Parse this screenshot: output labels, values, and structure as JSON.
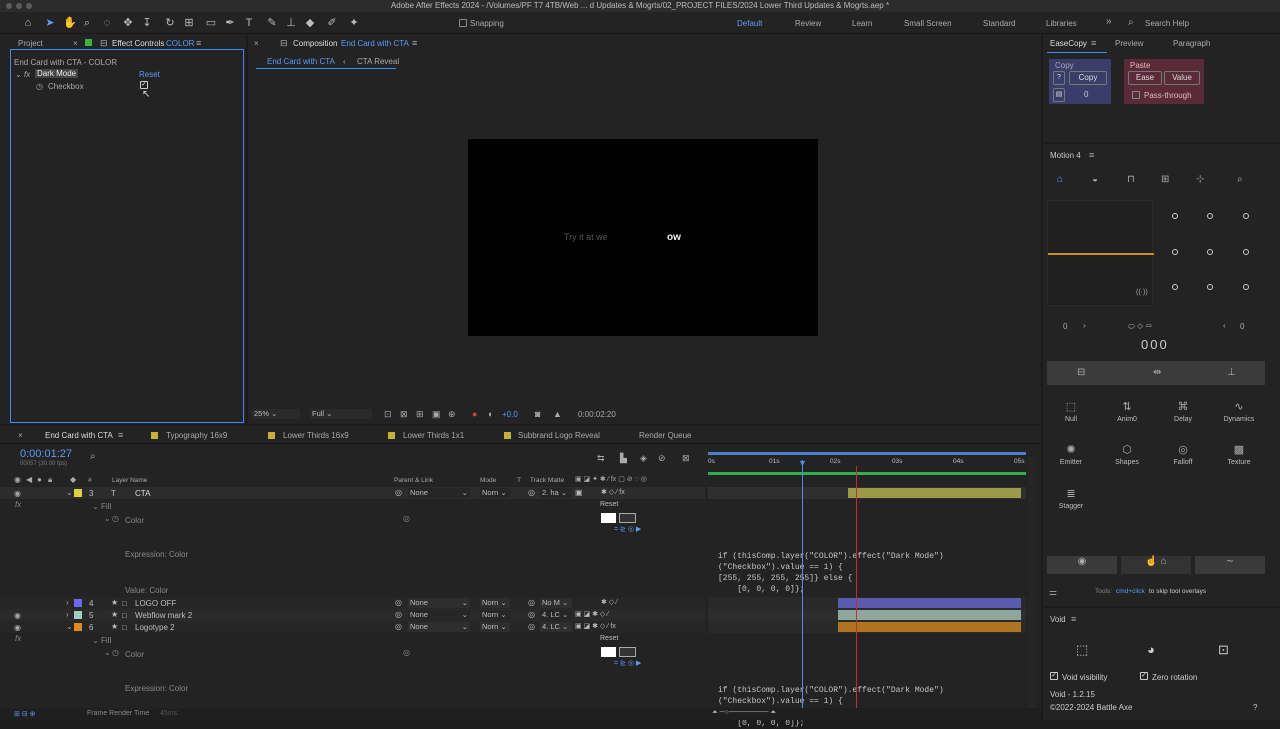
{
  "window": {
    "title": "Adobe After Effects 2024 - /Volumes/PF T7 4TB/Web ... d Updates & Mogrts/02_PROJECT FILES/2024 Lower Third Updates & Mogrts.aep *"
  },
  "toolbar": {
    "snapping": "Snapping",
    "workspaces": [
      "Default",
      "Review",
      "Learn",
      "Small Screen",
      "Standard",
      "Libraries"
    ],
    "more": "»",
    "search_placeholder": "Search Help"
  },
  "project_tab": "Project",
  "effect_controls": {
    "tab": "Effect Controls",
    "tab_layer": "COLOR",
    "header": "End Card with CTA - COLOR",
    "fx": "fx",
    "effect_name": "Dark Mode",
    "reset": "Reset",
    "checkbox_label": "Checkbox"
  },
  "composition": {
    "tab": "Composition",
    "tab_name": "End Card with CTA",
    "breadcrumb_current": "End Card with CTA",
    "breadcrumb_next": "CTA Reveal",
    "comp_text_dim": "Try it at we",
    "comp_text_bright": "ow",
    "zoom": "25%",
    "resolution": "Full",
    "exposure": "+0.0",
    "timecode": "0:00:02:20"
  },
  "timeline": {
    "tabs": [
      "End Card with CTA",
      "Typography 16x9",
      "Lower Thirds 16x9",
      "Lower Thirds 1x1",
      "Subbrand Logo Reveal",
      "Render Queue"
    ],
    "timecode": "0:00:01:27",
    "fps": "00057 (30.00 fps)",
    "col_hash": "#",
    "col_layer": "Layer Name",
    "col_parent": "Parent & Link",
    "col_mode": "Mode",
    "col_t": "T",
    "col_trackmatte": "Track Matte",
    "ruler": [
      "0s",
      "01s",
      "02s",
      "03s",
      "04s",
      "05s"
    ],
    "layers": [
      {
        "num": "3",
        "name": "CTA",
        "type": "T",
        "color": "#e0d040",
        "parent": "None",
        "mode": "Norn",
        "matte": "2. ha"
      },
      {
        "num": "4",
        "name": "LOGO OFF",
        "type": "□",
        "color": "#6a6aee",
        "parent": "None",
        "mode": "Norn",
        "matte": "No M"
      },
      {
        "num": "5",
        "name": "Webflow mark 2",
        "type": "□",
        "color": "#9ed0c2",
        "parent": "None",
        "mode": "Norn",
        "matte": "4. LC"
      },
      {
        "num": "6",
        "name": "Logotype 2",
        "type": "□",
        "color": "#e08a20",
        "parent": "None",
        "mode": "Norn",
        "matte": "4. LC"
      }
    ],
    "fill": "Fill",
    "color": "Color",
    "reset": "Reset",
    "expression": "Expression: Color",
    "value_color": "Value: Color",
    "code_lines": [
      "if (thisComp.layer(\"COLOR\").effect(\"Dark Mode\")",
      "(\"Checkbox\").value == 1) {",
      "[255, 255, 255, 255]} else {",
      "    [0, 0, 0, 0]};"
    ],
    "status": "Frame Render Time",
    "render_time": "45ms"
  },
  "easecopy": {
    "tabs": [
      "EaseCopy",
      "Preview",
      "Paragraph"
    ],
    "copy_label": "Copy",
    "copy_btn": "Copy",
    "help": "?",
    "zero": "0",
    "paste_label": "Paste",
    "ease_btn": "Ease",
    "value_btn": "Value",
    "passthrough": "Pass-through"
  },
  "motion": {
    "title": "Motion 4",
    "left_val": "0",
    "right_val": "0",
    "counter": "000",
    "tools": [
      "Null",
      "Anim0",
      "Delay",
      "Dynamics",
      "Emitter",
      "Shapes",
      "Falloff",
      "Texture",
      "Stagger"
    ],
    "hint_prefix": "Tools:",
    "hint_key": "cmd+click",
    "hint_rest": "to skip tool overlays"
  },
  "void": {
    "title": "Void",
    "visibility": "Void visibility",
    "zero_rotation": "Zero rotation",
    "version": "Void - 1.2.15",
    "copyright": "©2022-2024 Battle Axe",
    "help": "?"
  }
}
